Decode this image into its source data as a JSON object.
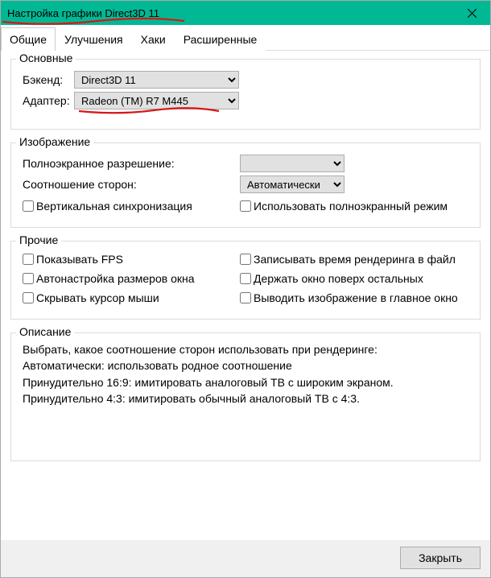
{
  "window": {
    "title": "Настройка графики Direct3D 11"
  },
  "tabs": {
    "general": "Общие",
    "enhance": "Улучшения",
    "hacks": "Хаки",
    "advanced": "Расширенные"
  },
  "group_basic": {
    "legend": "Основные",
    "backend_label": "Бэкенд:",
    "backend_value": "Direct3D 11",
    "adapter_label": "Адаптер:",
    "adapter_value": "Radeon (TM) R7 M445"
  },
  "group_image": {
    "legend": "Изображение",
    "fullscreen_res_label": "Полноэкранное разрешение:",
    "fullscreen_res_value": "",
    "aspect_label": "Соотношение сторон:",
    "aspect_value": "Автоматически",
    "vsync_label": "Вертикальная синхронизация",
    "fullscreen_mode_label": "Использовать полноэкранный режим"
  },
  "group_misc": {
    "legend": "Прочие",
    "show_fps": "Показывать FPS",
    "log_render_time": "Записывать время рендеринга в файл",
    "autoadjust": "Автонастройка размеров окна",
    "on_top": "Держать окно поверх остальных",
    "hide_cursor": "Скрывать курсор мыши",
    "render_to_main": "Выводить изображение в главное окно"
  },
  "group_desc": {
    "legend": "Описание",
    "line1": "Выбрать, какое соотношение сторон использовать при рендеринге:",
    "line2": "Автоматически: использовать родное соотношение",
    "line3": "Принудительно 16:9: имитировать аналоговый ТВ с широким экраном.",
    "line4": "Принудительно 4:3: имитировать обычный аналоговый ТВ с 4:3."
  },
  "footer": {
    "close": "Закрыть"
  }
}
